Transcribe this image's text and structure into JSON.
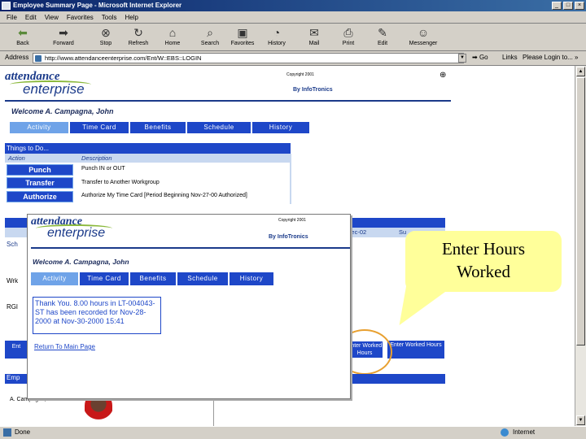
{
  "window": {
    "title": "Employee Summary Page - Microsoft Internet Explorer",
    "min": "_",
    "max": "□",
    "close": "×"
  },
  "menu": [
    "File",
    "Edit",
    "View",
    "Favorites",
    "Tools",
    "Help"
  ],
  "toolbar": [
    {
      "label": "Back",
      "icon": "back-arrow-icon"
    },
    {
      "label": "Forward",
      "icon": "forward-arrow-icon"
    },
    {
      "label": "Stop",
      "icon": "stop-icon"
    },
    {
      "label": "Refresh",
      "icon": "refresh-icon"
    },
    {
      "label": "Home",
      "icon": "home-icon"
    },
    {
      "label": "Search",
      "icon": "search-icon"
    },
    {
      "label": "Favorites",
      "icon": "favorites-icon"
    },
    {
      "label": "History",
      "icon": "history-icon"
    },
    {
      "label": "Mail",
      "icon": "mail-icon"
    },
    {
      "label": "Print",
      "icon": "print-icon"
    },
    {
      "label": "Edit",
      "icon": "edit-icon"
    },
    {
      "label": "Messenger",
      "icon": "messenger-icon"
    }
  ],
  "address": {
    "label": "Address",
    "url": "http://www.attendanceenterprise.com/Ent/W::EBS::LOGIN",
    "go": "Go",
    "links": "Links",
    "login": "Please Login to... »"
  },
  "status": {
    "left": "Done",
    "zone": "Internet"
  },
  "page": {
    "logo_top": "attendance",
    "logo_bottom": "enterprise",
    "copyright": "Copyright 2001",
    "by": "By InfoTronics",
    "welcome": "Welcome A. Campagna, John",
    "tabs": [
      "Activity",
      "Time Card",
      "Benefits",
      "Schedule",
      "History"
    ],
    "things_header": "Things to Do...",
    "col_action": "Action",
    "col_description": "Description",
    "actions": [
      {
        "label": "Punch",
        "desc": "Punch IN or OUT"
      },
      {
        "label": "Transfer",
        "desc": "Transfer to Another Workgroup"
      },
      {
        "label": "Authorize",
        "desc": "Authorize My Time Card [Period Beginning Nov-27-00 Authorized]"
      }
    ],
    "behind_labels": {
      "sch": "Sch",
      "wrk": "Wrk",
      "rgl": "RGl",
      "ent": "Ent",
      "emp": "Emp",
      "dec": "Dec-02",
      "sun": "Su"
    },
    "user_name": "A. Campagna, John",
    "right_buttons": [
      "Enter Worked Hours",
      "Enter Worked Hours"
    ]
  },
  "popup": {
    "logo_top": "attendance",
    "logo_bottom": "enterprise",
    "copyright": "Copyright 2001",
    "by": "By InfoTronics",
    "welcome": "Welcome A. Campagna, John",
    "tabs": [
      "Activity",
      "Time Card",
      "Benefits",
      "Schedule",
      "History"
    ],
    "message": "Thank You. 8.00 hours in LT-004043-ST has been recorded for Nov-28-2000 at Nov-30-2000 15:41",
    "return_link": "Return To Main Page"
  },
  "callout": {
    "line1": "Enter Hours",
    "line2": "Worked"
  }
}
